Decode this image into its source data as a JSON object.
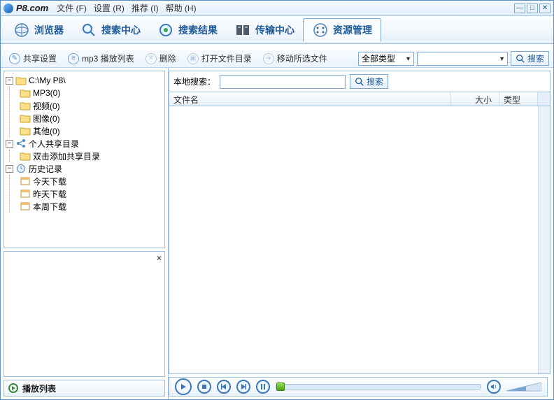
{
  "app": {
    "title": "P8.com"
  },
  "menu": {
    "file": "文件 (F)",
    "settings": "设置 (R)",
    "recommend": "推荐 (I)",
    "help": "帮助 (H)"
  },
  "tabs": {
    "browser": "浏览器",
    "search_center": "搜索中心",
    "search_results": "搜索结果",
    "transfer_center": "传输中心",
    "resource_mgmt": "资源管理"
  },
  "toolbar": {
    "share_settings": "共享设置",
    "mp3_playlist": "mp3 播放列表",
    "delete": "删除",
    "open_file_dir": "打开文件目录",
    "move_selected": "移动所选文件",
    "type_filter": "全部类型",
    "search": "搜索"
  },
  "tree": {
    "root": "C:\\My P8\\",
    "mp3": "MP3(0)",
    "video": "视频(0)",
    "image": "图像(0)",
    "other": "其他(0)",
    "personal_share": "个人共享目录",
    "dblclick_add": "双击添加共享目录",
    "history": "历史记录",
    "today": "今天下载",
    "yesterday": "昨天下载",
    "thisweek": "本周下载"
  },
  "playlist": {
    "label": "播放列表"
  },
  "main": {
    "local_search_label": "本地搜索：",
    "search_btn": "搜索",
    "col_name": "文件名",
    "col_size": "大小",
    "col_type": "类型"
  },
  "colors": {
    "accent": "#1f5a99",
    "border": "#9cbfe0"
  }
}
